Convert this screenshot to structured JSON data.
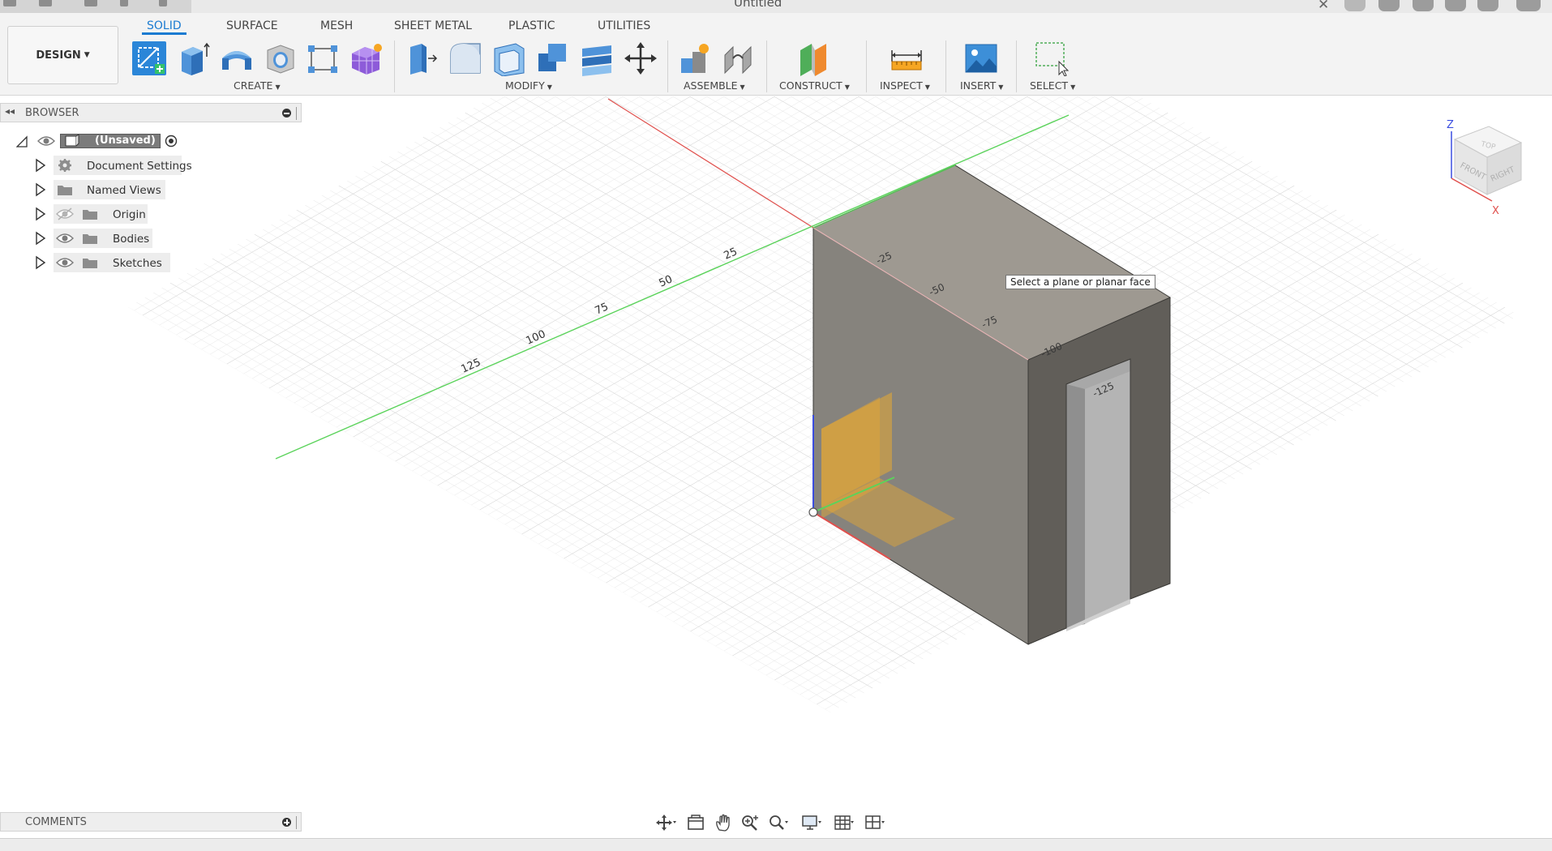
{
  "window": {
    "title": "Untitled"
  },
  "workspace": {
    "mode_label": "DESIGN"
  },
  "tabs": [
    {
      "label": "SOLID",
      "active": true
    },
    {
      "label": "SURFACE",
      "active": false
    },
    {
      "label": "MESH",
      "active": false
    },
    {
      "label": "SHEET METAL",
      "active": false
    },
    {
      "label": "PLASTIC",
      "active": false
    },
    {
      "label": "UTILITIES",
      "active": false
    }
  ],
  "toolbar_groups": {
    "create": "CREATE",
    "modify": "MODIFY",
    "assemble": "ASSEMBLE",
    "construct": "CONSTRUCT",
    "inspect": "INSPECT",
    "insert": "INSERT",
    "select": "SELECT"
  },
  "browser": {
    "title": "BROWSER",
    "root_label": "(Unsaved)",
    "items": [
      {
        "label": "Document Settings",
        "icon": "gear-icon"
      },
      {
        "label": "Named Views",
        "icon": "folder-icon"
      },
      {
        "label": "Origin",
        "icon": "folder-icon",
        "hidden": true
      },
      {
        "label": "Bodies",
        "icon": "folder-icon"
      },
      {
        "label": "Sketches",
        "icon": "folder-icon"
      }
    ]
  },
  "viewport": {
    "tooltip": "Select a plane or planar face",
    "axis_labels": [
      "125",
      "100",
      "75",
      "50",
      "25"
    ],
    "face_labels": [
      "-25",
      "-50",
      "-75",
      "-100",
      "-125"
    ],
    "viewcube": {
      "top": "TOP",
      "front": "FRONT",
      "right": "RIGHT",
      "axis_z": "Z",
      "axis_x": "X"
    }
  },
  "comments": {
    "title": "COMMENTS"
  },
  "colors": {
    "accent": "#1a7bd1",
    "x_axis": "#e0504d",
    "y_axis": "#5bd35b",
    "z_axis": "#3a4de0",
    "body_top": "#9e9991",
    "body_front": "#86837d",
    "body_right": "#615e59",
    "plane": "#e8a933"
  }
}
